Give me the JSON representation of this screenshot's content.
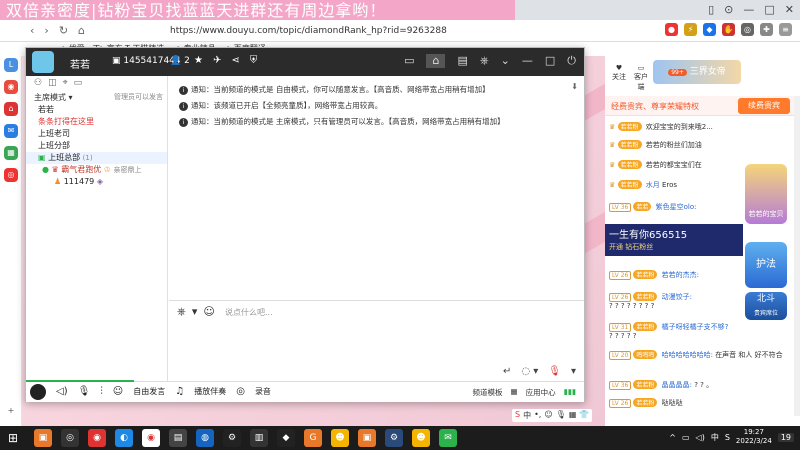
{
  "banner": {
    "text": "双倍亲密度|钻粉宝贝找蓝蓝天进群还有周边拿哟！"
  },
  "browser": {
    "url": "https://www.douyu.com/topic/diamondRank_hp?rid=9263288",
    "bookmarks": [
      "▲ 优爱 · 工",
      "▲ 京东",
      "T 天猫精选",
      "▲ 专业精品",
      "▲ 百度翻译"
    ]
  },
  "client": {
    "title": "若若",
    "room_id": "1455417444",
    "user_count": "2",
    "mode_label": "主席模式",
    "admin_note": "管理员可以发言",
    "channels": [
      {
        "label": "若若",
        "style": "normal"
      },
      {
        "label": "条条打得在这里",
        "style": "red"
      },
      {
        "label": "上班老司",
        "style": "normal"
      },
      {
        "label": "上班分部",
        "style": "normal"
      },
      {
        "label": "上班总部",
        "style": "sel",
        "count": "(1)"
      },
      {
        "label": "霸气君跑优",
        "style": "normal",
        "extra": "亲密鼎上"
      },
      {
        "label": "111479",
        "style": "normal"
      }
    ],
    "notices": [
      "通知：当前频道的模式是 自由模式，你可以随意发言。【高音质、网络带宽占用稍有增加】",
      "通知：该频道已开启【全频亮童质】，网络带宽占用较高。",
      "通知：当前频道的模式是 主席模式，只有管理员可以发言。【高音质，网络带宽占用稍有增加】"
    ],
    "input_placeholder": "说点什么吧...",
    "bottom_bar": {
      "free_speak": "自由发言",
      "play_music": "播放伴奏",
      "record": "录音",
      "quality": "频道模板",
      "app_center": "应用中心"
    }
  },
  "right_panel": {
    "follow": "关注",
    "client_dl": "客户端",
    "fans_count": "99+",
    "banner_text": "三界女帝",
    "head_title": "经费贵宾、尊享荣耀特权",
    "head_button": "续费贵宾",
    "rows": [
      {
        "badge": "若若粉",
        "name": "",
        "msg": "欢迎宝宝的到来哦2..."
      },
      {
        "badge": "若若粉",
        "name": "",
        "msg": "若若的粉丝们加油"
      },
      {
        "badge": "若若粉",
        "name": "",
        "msg": "若若的都宝宝们在"
      },
      {
        "badge": "若若粉",
        "name": "水月",
        "msg": "Eros"
      },
      {
        "lv": "LV 36",
        "badge": "若若",
        "name": "紫色星空olo:",
        "msg": ""
      }
    ],
    "ad_title": "一生有你656515",
    "ad_sub": "开通  钻石粉丝",
    "chat": [
      {
        "lv": "LV 26",
        "badge": "若若粉",
        "name": "若若的杰杰:",
        "msg": ""
      },
      {
        "lv": "LV 26",
        "badge": "若若粉",
        "name": "动漫饺子:",
        "msg": "? ? ? ? ? ? ? ?"
      },
      {
        "lv": "LV 31",
        "badge": "若若粉",
        "name": "橘子呀轻橘子支不够?",
        "msg": "? ? ? ? ?"
      },
      {
        "lv": "LV 20",
        "badge": "鸣鸣鸣",
        "name": "哈哈哈哈哈哈哈:",
        "msg": "在声音 和人 好不符合"
      },
      {
        "lv": "LV 36",
        "badge": "若若粉",
        "name": "晶晶晶晶:",
        "msg": "? ? 。"
      },
      {
        "lv": "LV 26",
        "badge": "若若粉",
        "name": "",
        "msg": "哒哒哒"
      }
    ],
    "floats": [
      "若若的宝贝",
      "护法",
      "北斗",
      "贵宾席位"
    ]
  },
  "taskbar": {
    "time": "19:27",
    "date": "2022/3/24",
    "lang": "中",
    "notif": "19"
  }
}
